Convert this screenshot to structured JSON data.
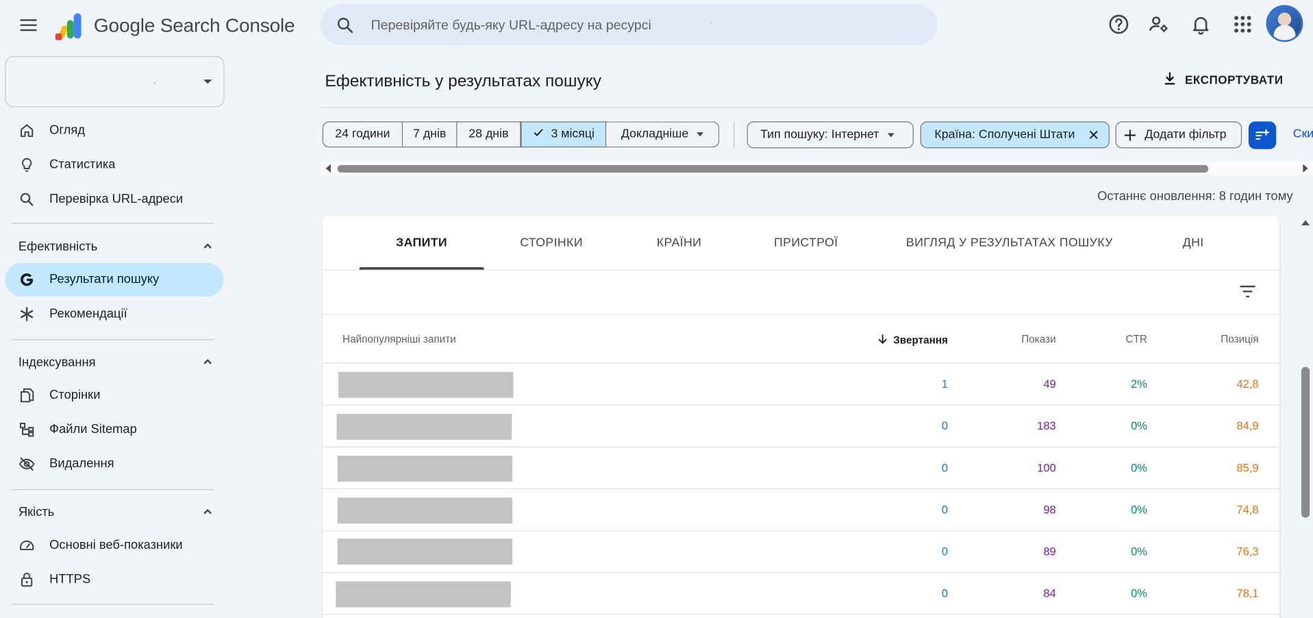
{
  "header": {
    "brand": "Google Search Console",
    "search_placeholder": "Перевіряйте будь-яку URL-адресу на ресурсі",
    "search_suffix": "."
  },
  "property": {
    "value": "·"
  },
  "sidebar": {
    "top_items": [
      {
        "label": "Огляд",
        "icon": "home-icon"
      },
      {
        "label": "Статистика",
        "icon": "lightbulb-icon"
      },
      {
        "label": "Перевірка URL-адреси",
        "icon": "search-icon"
      }
    ],
    "sections": [
      {
        "title": "Ефективність",
        "items": [
          {
            "label": "Результати пошуку",
            "icon": "google-g-icon",
            "active": true
          },
          {
            "label": "Рекомендації",
            "icon": "asterisk-icon"
          }
        ]
      },
      {
        "title": "Індексування",
        "items": [
          {
            "label": "Сторінки",
            "icon": "pages-icon"
          },
          {
            "label": "Файли Sitemap",
            "icon": "sitemap-icon"
          },
          {
            "label": "Видалення",
            "icon": "eye-off-icon"
          }
        ]
      },
      {
        "title": "Якість",
        "items": [
          {
            "label": "Основні веб-показники",
            "icon": "gauge-icon"
          },
          {
            "label": "HTTPS",
            "icon": "lock-icon"
          }
        ]
      }
    ]
  },
  "main": {
    "title": "Ефективність у результатах пошуку",
    "export_label": "ЕКСПОРТУВАТИ",
    "date_ranges": [
      "24 години",
      "7 днів",
      "28 днів",
      "3 місяці",
      "Докладніше"
    ],
    "selected_range": "3 місяці",
    "search_type_chip": "Тип пошуку: Інтернет",
    "country_chip": "Країна: Сполучені Штати",
    "add_filter": "Додати фільтр",
    "cut_text": "Ски",
    "updated": "Останнє оновлення: 8 годин тому"
  },
  "tabs": [
    "ЗАПИТИ",
    "СТОРІНКИ",
    "КРАЇНИ",
    "ПРИСТРОЇ",
    "ВИГЛЯД У РЕЗУЛЬТАТАХ ПОШУКУ",
    "ДНІ"
  ],
  "table": {
    "headers": {
      "query": "Найпопулярніші запити",
      "clicks": "Звертання",
      "impressions": "Покази",
      "ctr": "CTR",
      "position": "Позиція"
    },
    "rows": [
      {
        "clicks": "1",
        "impressions": "49",
        "ctr": "2%",
        "position": "42,8"
      },
      {
        "clicks": "0",
        "impressions": "183",
        "ctr": "0%",
        "position": "84,9"
      },
      {
        "clicks": "0",
        "impressions": "100",
        "ctr": "0%",
        "position": "85,9"
      },
      {
        "clicks": "0",
        "impressions": "98",
        "ctr": "0%",
        "position": "74,8"
      },
      {
        "clicks": "0",
        "impressions": "89",
        "ctr": "0%",
        "position": "76,3"
      },
      {
        "clicks": "0",
        "impressions": "84",
        "ctr": "0%",
        "position": "78,1"
      }
    ]
  },
  "colors": {
    "clicks": "#1a73e8",
    "impressions": "#7b1fa2",
    "ctr": "#00897b",
    "position": "#e8710a",
    "active_nav": "#c2e7ff",
    "primary": "#0b57d0"
  }
}
